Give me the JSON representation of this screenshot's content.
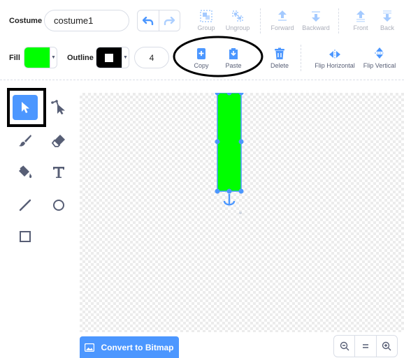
{
  "header": {
    "costume_label": "Costume",
    "costume_name": "costume1",
    "fill_label": "Fill",
    "outline_label": "Outline",
    "outline_width": "4"
  },
  "colors": {
    "fill": "#00ff00",
    "outline": "#000000",
    "accent": "#4c97ff"
  },
  "toolbar": {
    "group": "Group",
    "ungroup": "Ungroup",
    "forward": "Forward",
    "backward": "Backward",
    "front": "Front",
    "back": "Back",
    "copy": "Copy",
    "paste": "Paste",
    "delete": "Delete",
    "flip_horizontal": "Flip Horizontal",
    "flip_vertical": "Flip Vertical"
  },
  "tools": [
    {
      "name": "select",
      "icon": "arrow-select-icon",
      "selected": true
    },
    {
      "name": "reshape",
      "icon": "reshape-icon"
    },
    {
      "name": "brush",
      "icon": "brush-icon"
    },
    {
      "name": "eraser",
      "icon": "eraser-icon"
    },
    {
      "name": "fill",
      "icon": "fill-bucket-icon"
    },
    {
      "name": "text",
      "icon": "text-icon"
    },
    {
      "name": "line",
      "icon": "line-icon"
    },
    {
      "name": "circle",
      "icon": "circle-icon"
    },
    {
      "name": "rectangle",
      "icon": "rectangle-icon"
    }
  ],
  "bottom": {
    "convert_label": "Convert to Bitmap",
    "zoom_out": "zoom-out-icon",
    "zoom_reset": "zoom-reset-icon",
    "zoom_in": "zoom-in-icon"
  }
}
